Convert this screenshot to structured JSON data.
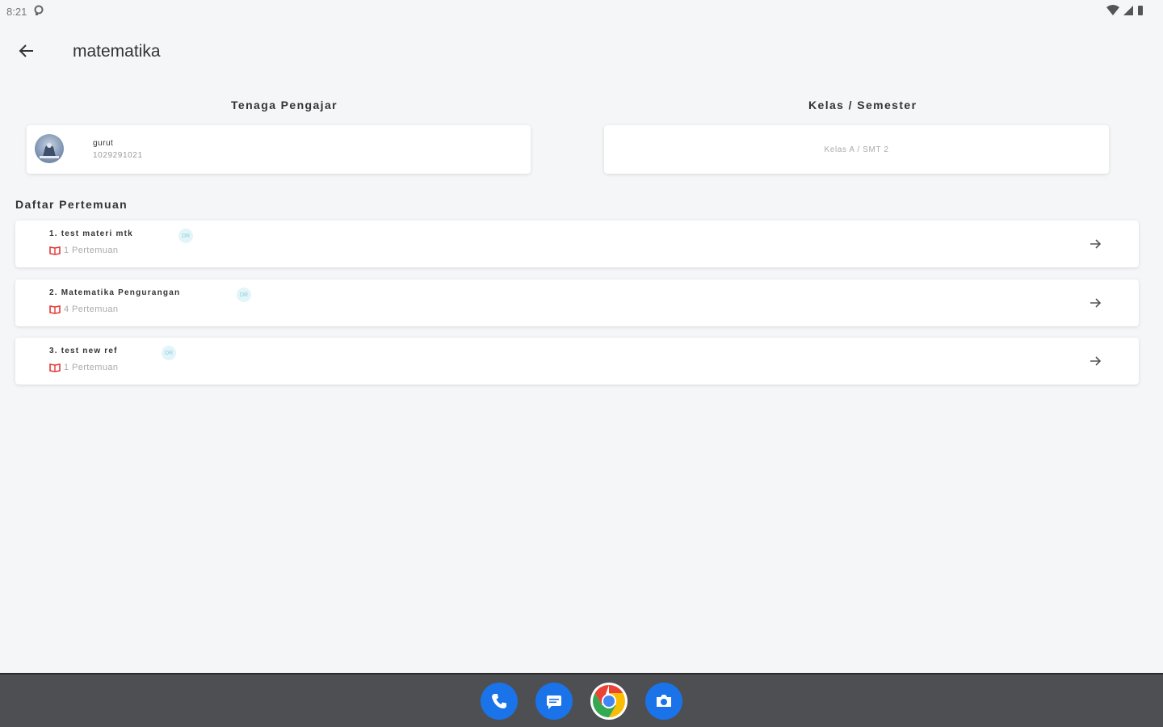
{
  "status_bar": {
    "time": "8:21"
  },
  "app_bar": {
    "title": "matematika"
  },
  "teacher_section": {
    "heading": "Tenaga Pengajar",
    "name": "gurut",
    "id": "1029291021"
  },
  "class_section": {
    "heading": "Kelas / Semester",
    "value": "Kelas A / SMT 2"
  },
  "meetings_section": {
    "heading": "Daftar Pertemuan",
    "items": [
      {
        "title": "1. test materi mtk",
        "badge": "DR",
        "count": "1 Pertemuan"
      },
      {
        "title": "2. Matematika Pengurangan",
        "badge": "DR",
        "count": "4 Pertemuan"
      },
      {
        "title": "3. test new ref",
        "badge": "DR",
        "count": "1 Pertemuan"
      }
    ]
  },
  "colors": {
    "background": "#f5f6f8",
    "accent_icon": "#e53935",
    "badge_bg": "#e3f5f8",
    "nav_bar": "#4e4f52"
  },
  "dock": [
    "phone-icon",
    "messages-icon",
    "chrome-icon",
    "camera-icon"
  ]
}
